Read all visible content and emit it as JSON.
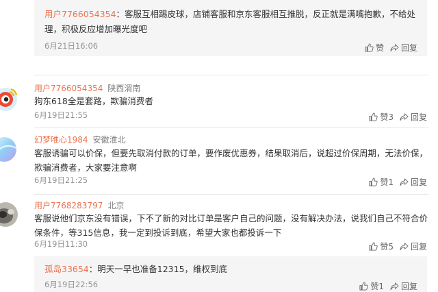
{
  "top_reply": {
    "user": "用户7766054354",
    "text": "：客服互相踢皮球，店铺客服和京东客服相互推脱，反正就是满嘴抱歉，不给处理，积极反应增加曝光度吧",
    "time": "6月21日16:06",
    "like_label": "赞",
    "reply_label": "回复"
  },
  "comments": [
    {
      "user": "用户7766054354",
      "location": "陕西渭南",
      "text": "狗东618全是套路，欺骗消费者",
      "time": "6月19日21:55",
      "like_label": "赞3",
      "reply_label": "回复"
    },
    {
      "user": "幻梦唯心1984",
      "location": "安徽淮北",
      "text": "客服诱骗可以价保，但要先取消付款的订单，要作废优惠券，结果取消后，说超过价保周期，无法价保，欺骗消费者，大家要注意啊",
      "time": "6月19日21:25",
      "like_label": "赞1",
      "reply_label": "回复"
    },
    {
      "user": "用户7768283797",
      "location": "北京",
      "text": "客服说他们京东没有错误，下不了新的对比订单是客户自己的问题，没有解决办法，说我们自己不符合价保条件，等315信息，我一定到投诉到底，希望大家也都投诉一下",
      "time": "6月19日11:30",
      "like_label": "赞5",
      "reply_label": "回复"
    }
  ],
  "bottom_reply": {
    "user": "孤岛33654",
    "text": "：明天一早也准备12315，维权到底",
    "time": "6月19日22:56",
    "like_label": "赞1",
    "reply_label": "回复"
  },
  "colors": {
    "username": "#eb7350",
    "text": "#333333",
    "meta": "#939393",
    "reply_bg": "#f5f5f5"
  }
}
